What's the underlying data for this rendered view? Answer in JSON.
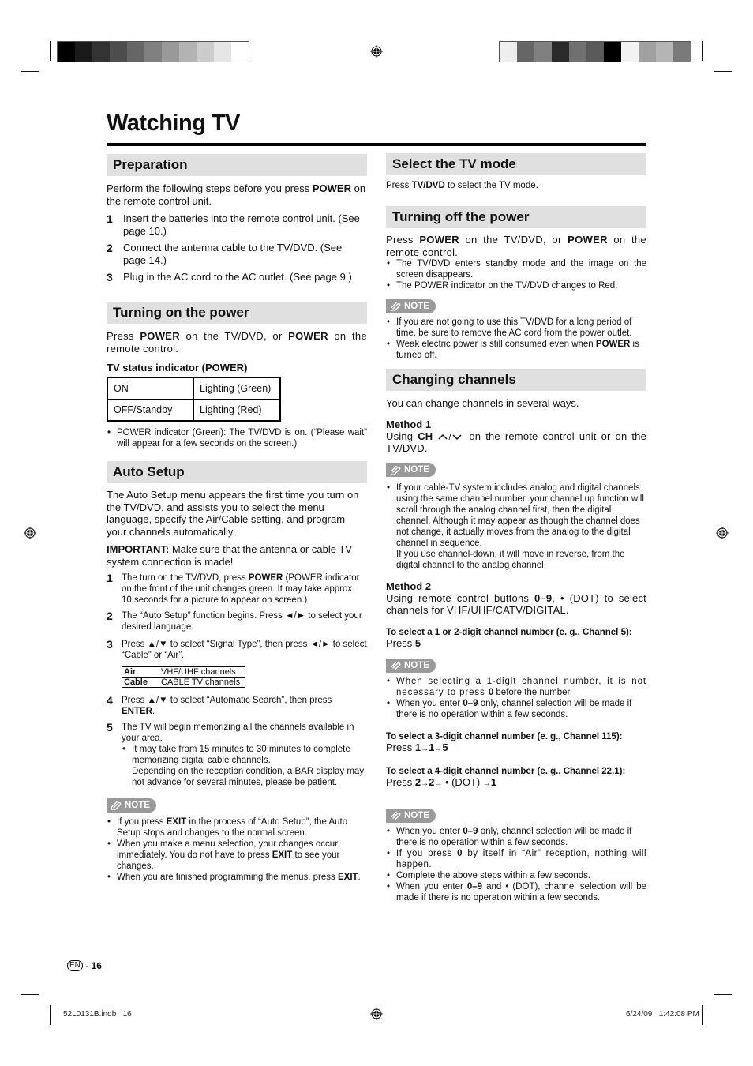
{
  "print_marks": {
    "left_swatches": [
      "#000000",
      "#1a1a1a",
      "#333333",
      "#4d4d4d",
      "#666666",
      "#808080",
      "#999999",
      "#b3b3b3",
      "#cccccc",
      "#e6e6e6",
      "#ffffff"
    ],
    "right_swatches": [
      "#eeeeee",
      "#666666",
      "#808080",
      "#2a2a2a",
      "#707070",
      "#5a5a5a",
      "#000000",
      "#f2f2f2",
      "#a0a0a0",
      "#b5b5b5",
      "#7a7a7a"
    ]
  },
  "page": {
    "title": "Watching TV"
  },
  "left": {
    "preparation": {
      "heading": "Preparation",
      "intro_a": "Perform the following steps before you press ",
      "intro_b": "POWER",
      "intro_c": " on the remote control unit.",
      "steps": [
        {
          "n": "1",
          "text": "Insert the batteries into the remote control unit. (See page 10.)"
        },
        {
          "n": "2",
          "text": "Connect the antenna cable to the TV/DVD. (See page 14.)"
        },
        {
          "n": "3",
          "text": "Plug in the AC cord to the AC outlet. (See page 9.)"
        }
      ]
    },
    "power_on": {
      "heading": "Turning on the power",
      "p_a": "Press ",
      "p_b": "POWER",
      "p_c": " on the TV/DVD, or ",
      "p_d": "POWER",
      "p_e": " on the remote control.",
      "table_title": "TV status indicator (POWER)",
      "table_rows": [
        {
          "state": "ON",
          "indicator": "Lighting (Green)"
        },
        {
          "state": "OFF/Standby",
          "indicator": "Lighting (Red)"
        }
      ],
      "bullet": "POWER indicator (Green): The TV/DVD is on. (“Please wait” will appear for a few seconds on the screen.)"
    },
    "auto_setup": {
      "heading": "Auto Setup",
      "intro": "The Auto Setup menu appears the first time you turn on the TV/DVD, and assists you to select the menu language, specify the Air/Cable setting, and program your channels automatically.",
      "important_label": "IMPORTANT:",
      "important_text": " Make sure that the antenna or cable TV system connection is made!",
      "step1_a": "The turn on the TV/DVD, press ",
      "step1_b": "POWER",
      "step1_c": " (POWER indicator on the front of the unit changes green. It may take approx. 10 seconds for a picture to appear on screen.).",
      "step2": "The “Auto Setup” function begins. Press ◄/► to select your desired language.",
      "step3": "Press ▲/▼ to select “Signal Type”, then press ◄/► to select “Cable” or “Air”.",
      "signal_table": [
        {
          "type": "Air",
          "desc": "VHF/UHF channels"
        },
        {
          "type": "Cable",
          "desc": "CABLE TV channels"
        }
      ],
      "step4_a": "Press ▲/▼ to select “Automatic Search”, then press ",
      "step4_b": "ENTER",
      "step4_c": ".",
      "step5": "The TV will begin memorizing all the channels available in your area.",
      "step5_bullet": "It may take from 15 minutes to 30 minutes to complete memorizing digital cable channels.",
      "step5_bullet_cont": "Depending on the reception condition, a BAR display may not advance for several minutes, please be patient.",
      "note_label": "NOTE",
      "notes": [
        {
          "a": "If you press ",
          "b": "EXIT",
          "c": " in the process of “Auto Setup”, the Auto Setup stops and changes to the normal screen."
        },
        {
          "a": "When you make a menu selection, your changes occur immediately. You do not have to press ",
          "b": "EXIT",
          "c": " to see your changes."
        },
        {
          "a": "When you are finished programming the menus, press ",
          "b": "EXIT",
          "c": "."
        }
      ]
    }
  },
  "right": {
    "tv_mode": {
      "heading": "Select the TV mode",
      "p_a": "Press ",
      "p_b": "TV/DVD",
      "p_c": " to select the TV mode."
    },
    "power_off": {
      "heading": "Turning off the power",
      "p_a": "Press ",
      "p_b": "POWER",
      "p_c": " on the TV/DVD, or ",
      "p_d": "POWER",
      "p_e": " on the remote control.",
      "bullets": [
        "The TV/DVD enters standby mode and the image on the screen disappears.",
        "The POWER indicator on the TV/DVD changes to Red."
      ],
      "note_label": "NOTE",
      "note1": "If you are not going to use this TV/DVD for a long period of time, be sure to remove the AC cord from the power outlet.",
      "note2_a": "Weak electric power is still consumed even when ",
      "note2_b": "POWER",
      "note2_c": " is turned off."
    },
    "channels": {
      "heading": "Changing channels",
      "intro": "You can change channels in several ways.",
      "method1_label": "Method 1",
      "method1_a": "Using ",
      "method1_b": "CH",
      "method1_c": " on the remote control unit or on the TV/DVD.",
      "note_label": "NOTE",
      "method1_note": "If your cable-TV system includes analog and digital channels using the same channel number, your channel up function will scroll through the analog channel first, then the digital channel. Although it may appear as though the channel does not change, it actually moves from the analog to the digital channel in sequence.",
      "method1_note_cont": "If you use channel-down, it will move in reverse, from the digital channel to the analog channel.",
      "method2_label": "Method 2",
      "method2_a": "Using remote control buttons ",
      "method2_b": "0–9",
      "method2_c": ", • (DOT) to select channels for VHF/UHF/CATV/DIGITAL.",
      "sel12_label": "To select a 1 or 2-digit channel number (e. g., Channel 5):",
      "sel12_press": "Press ",
      "sel12_keys": "5",
      "sel12_notes": [
        {
          "a": "When selecting a 1-digit channel number, it is not necessary to press ",
          "b": "0",
          "c": " before the number."
        },
        {
          "a": "When you enter ",
          "b": "0–9",
          "c": " only, channel selection will be made if there is no operation within a few seconds."
        }
      ],
      "sel3_label": "To select a 3-digit channel number (e. g., Channel 115):",
      "sel3_press": "Press ",
      "sel3_keys": [
        "1",
        "1",
        "5"
      ],
      "sel4_label": "To select a 4-digit channel number (e. g., Channel 22.1):",
      "sel4_press": "Press ",
      "sel4_keys": [
        "2",
        "2",
        "• (DOT)",
        "1"
      ],
      "final_notes": [
        {
          "a": "When you enter ",
          "b": "0–9",
          "c": " only, channel selection will be made if there is no operation within a few seconds."
        },
        {
          "a": "If you press ",
          "b": "0",
          "c": " by itself in “Air” reception, nothing will happen."
        },
        {
          "a": "Complete the above steps within a few seconds.",
          "b": "",
          "c": ""
        },
        {
          "a": "When you enter ",
          "b": "0–9",
          "c": " and • (DOT), channel selection will be made if there is no operation within a few seconds."
        }
      ]
    }
  },
  "footer": {
    "lang": "EN",
    "page_sep": " - ",
    "page_num": "16",
    "file": "52L0131B.indb   16",
    "timestamp": "6/24/09   1:42:08 PM"
  }
}
